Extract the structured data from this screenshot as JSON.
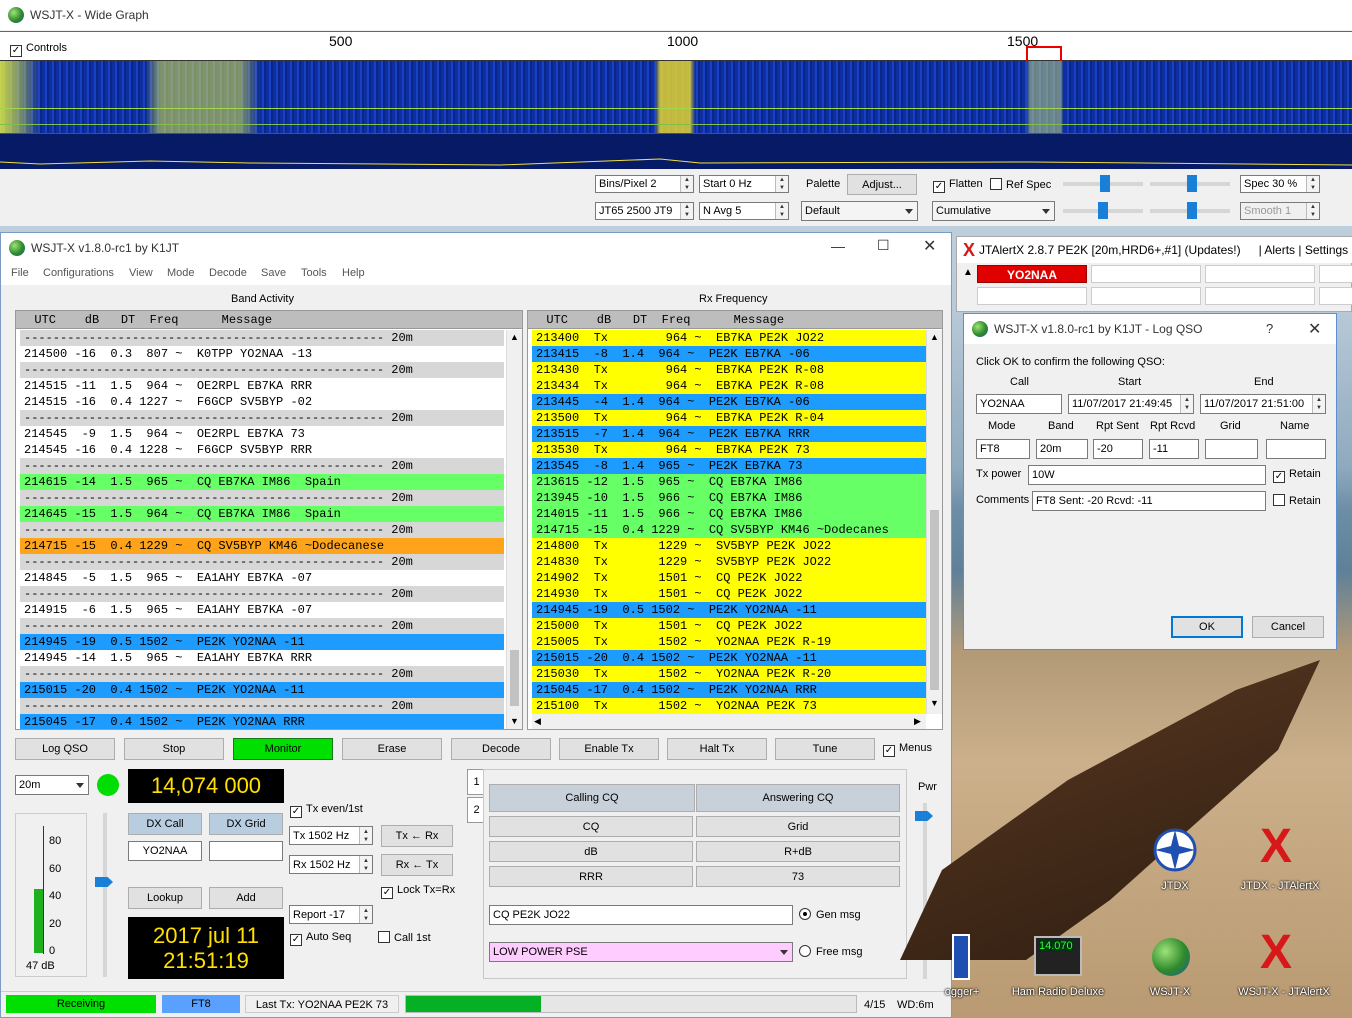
{
  "wide_graph": {
    "title": "WSJT-X - Wide Graph",
    "controls_label": "Controls",
    "scale": [
      "500",
      "1000",
      "1500"
    ],
    "bins_pixel": "Bins/Pixel  2",
    "start": "Start 0 Hz",
    "palette_label": "Palette",
    "adjust_btn": "Adjust...",
    "mode_field": "JT65  2500  JT9",
    "navg": "N Avg 5",
    "palette_value": "Default",
    "flatten": "Flatten",
    "ref_spec": "Ref Spec",
    "spec": "Spec 30 %",
    "cumulative": "Cumulative",
    "smooth": "Smooth  1"
  },
  "main": {
    "title": "WSJT-X   v1.8.0-rc1   by K1JT",
    "menu": [
      "File",
      "Configurations",
      "View",
      "Mode",
      "Decode",
      "Save",
      "Tools",
      "Help"
    ],
    "band_activity_label": "Band Activity",
    "rx_frequency_label": "Rx Frequency",
    "band_header": "  UTC    dB   DT  Freq      Message",
    "rx_header": "  UTC    dB   DT  Freq      Message",
    "band_rows": [
      {
        "t": "-------------------------------------------------- 20m",
        "c": "sep"
      },
      {
        "t": "214500 -16  0.3  807 ~  K0TPP YO2NAA -13",
        "c": "white"
      },
      {
        "t": "-------------------------------------------------- 20m",
        "c": "sep"
      },
      {
        "t": "214515 -11  1.5  964 ~  OE2RPL EB7KA RRR",
        "c": "white"
      },
      {
        "t": "214515 -16  0.4 1227 ~  F6GCP SV5BYP -02",
        "c": "white"
      },
      {
        "t": "-------------------------------------------------- 20m",
        "c": "sep"
      },
      {
        "t": "214545  -9  1.5  964 ~  OE2RPL EB7KA 73",
        "c": "white"
      },
      {
        "t": "214545 -16  0.4 1228 ~  F6GCP SV5BYP RRR",
        "c": "white"
      },
      {
        "t": "-------------------------------------------------- 20m",
        "c": "sep"
      },
      {
        "t": "214615 -14  1.5  965 ~  CQ EB7KA IM86  Spain",
        "c": "green"
      },
      {
        "t": "-------------------------------------------------- 20m",
        "c": "sep"
      },
      {
        "t": "214645 -15  1.5  964 ~  CQ EB7KA IM86  Spain",
        "c": "green"
      },
      {
        "t": "-------------------------------------------------- 20m",
        "c": "sep"
      },
      {
        "t": "214715 -15  0.4 1229 ~  CQ SV5BYP KM46 ~Dodecanese",
        "c": "orange"
      },
      {
        "t": "-------------------------------------------------- 20m",
        "c": "sep"
      },
      {
        "t": "214845  -5  1.5  965 ~  EA1AHY EB7KA -07",
        "c": "white"
      },
      {
        "t": "-------------------------------------------------- 20m",
        "c": "sep"
      },
      {
        "t": "214915  -6  1.5  965 ~  EA1AHY EB7KA -07",
        "c": "white"
      },
      {
        "t": "-------------------------------------------------- 20m",
        "c": "sep"
      },
      {
        "t": "214945 -19  0.5 1502 ~  PE2K YO2NAA -11",
        "c": "blue"
      },
      {
        "t": "214945 -14  1.5  965 ~  EA1AHY EB7KA RRR",
        "c": "white"
      },
      {
        "t": "-------------------------------------------------- 20m",
        "c": "sep"
      },
      {
        "t": "215015 -20  0.4 1502 ~  PE2K YO2NAA -11",
        "c": "blue"
      },
      {
        "t": "-------------------------------------------------- 20m",
        "c": "sep"
      },
      {
        "t": "215045 -17  0.4 1502 ~  PE2K YO2NAA RRR",
        "c": "blue"
      }
    ],
    "rx_rows": [
      {
        "t": "213400  Tx        964 ~  EB7KA PE2K JO22",
        "c": "yellow"
      },
      {
        "t": "213415  -8  1.4  964 ~  PE2K EB7KA -06",
        "c": "blue"
      },
      {
        "t": "213430  Tx        964 ~  EB7KA PE2K R-08",
        "c": "yellow"
      },
      {
        "t": "213434  Tx        964 ~  EB7KA PE2K R-08",
        "c": "yellow"
      },
      {
        "t": "213445  -4  1.4  964 ~  PE2K EB7KA -06",
        "c": "blue"
      },
      {
        "t": "213500  Tx        964 ~  EB7KA PE2K R-04",
        "c": "yellow"
      },
      {
        "t": "213515  -7  1.4  964 ~  PE2K EB7KA RRR",
        "c": "blue"
      },
      {
        "t": "213530  Tx        964 ~  EB7KA PE2K 73",
        "c": "yellow"
      },
      {
        "t": "213545  -8  1.4  965 ~  PE2K EB7KA 73",
        "c": "blue"
      },
      {
        "t": "213615 -12  1.5  965 ~  CQ EB7KA IM86",
        "c": "green"
      },
      {
        "t": "213945 -10  1.5  966 ~  CQ EB7KA IM86",
        "c": "green"
      },
      {
        "t": "214015 -11  1.5  966 ~  CQ EB7KA IM86",
        "c": "green"
      },
      {
        "t": "214715 -15  0.4 1229 ~  CQ SV5BYP KM46 ~Dodecanes",
        "c": "green"
      },
      {
        "t": "214800  Tx       1229 ~  SV5BYP PE2K JO22",
        "c": "yellow"
      },
      {
        "t": "214830  Tx       1229 ~  SV5BYP PE2K JO22",
        "c": "yellow"
      },
      {
        "t": "214902  Tx       1501 ~  CQ PE2K JO22",
        "c": "yellow"
      },
      {
        "t": "214930  Tx       1501 ~  CQ PE2K JO22",
        "c": "yellow"
      },
      {
        "t": "214945 -19  0.5 1502 ~  PE2K YO2NAA -11",
        "c": "blue"
      },
      {
        "t": "215000  Tx       1501 ~  CQ PE2K JO22",
        "c": "yellow"
      },
      {
        "t": "215005  Tx       1502 ~  YO2NAA PE2K R-19",
        "c": "yellow"
      },
      {
        "t": "215015 -20  0.4 1502 ~  PE2K YO2NAA -11",
        "c": "blue"
      },
      {
        "t": "215030  Tx       1502 ~  YO2NAA PE2K R-20",
        "c": "yellow"
      },
      {
        "t": "215045 -17  0.4 1502 ~  PE2K YO2NAA RRR",
        "c": "blue"
      },
      {
        "t": "215100  Tx       1502 ~  YO2NAA PE2K 73",
        "c": "yellow"
      }
    ],
    "buttons": {
      "log_qso": "Log QSO",
      "stop": "Stop",
      "monitor": "Monitor",
      "erase": "Erase",
      "decode": "Decode",
      "enable_tx": "Enable Tx",
      "halt_tx": "Halt Tx",
      "tune": "Tune",
      "menus": "Menus"
    },
    "band": "20m",
    "frequency": "14,074 000",
    "dx_call_btn": "DX Call",
    "dx_grid_btn": "DX Grid",
    "dx_call_value": "YO2NAA",
    "dx_grid_value": "",
    "lookup_btn": "Lookup",
    "add_btn": "Add",
    "meter_ticks": [
      "80",
      "60",
      "40",
      "20",
      "0"
    ],
    "meter_db": "47 dB",
    "date": "2017 jul 11",
    "time": "21:51:19",
    "tx_even": "Tx even/1st",
    "tx_hz": "Tx  1502  Hz",
    "rx_hz": "Rx  1502  Hz",
    "tx_from_rx": "Tx ← Rx",
    "rx_from_tx": "Rx ← Tx",
    "lock_tx_rx": "Lock Tx=Rx",
    "report": "Report -17",
    "auto_seq": "Auto Seq",
    "call_1st": "Call 1st",
    "tab1": "1",
    "tab2": "2",
    "calling_cq": "Calling CQ",
    "answering_cq": "Answering CQ",
    "cq": "CQ",
    "grid": "Grid",
    "db": "dB",
    "r_db": "R+dB",
    "rrr": "RRR",
    "seventy_three": "73",
    "gen_msg_text": "CQ PE2K JO22",
    "gen_msg": "Gen msg",
    "free_msg_text": "LOW POWER PSE",
    "free_msg": "Free msg",
    "pwr": "Pwr",
    "status": {
      "receiving": "Receiving",
      "mode": "FT8",
      "last_tx": "Last Tx: YO2NAA PE2K 73",
      "progress": 0.3,
      "count": "4/15",
      "wd": "WD:6m"
    }
  },
  "jtalert": {
    "title": "JTAlertX 2.8.7 PE2K [20m,HRD6+,#1] (Updates!)",
    "links": "| Alerts | Settings | V",
    "callsign": "YO2NAA"
  },
  "logqso": {
    "title": "WSJT-X   v1.8.0-rc1   by K1JT - Log QSO",
    "help": "?",
    "prompt": "Click OK to confirm the following QSO:",
    "call_label": "Call",
    "start_label": "Start",
    "end_label": "End",
    "call": "YO2NAA",
    "start": "11/07/2017 21:49:45",
    "end": "11/07/2017 21:51:00",
    "mode_label": "Mode",
    "band_label": "Band",
    "sent_label": "Rpt Sent",
    "rcvd_label": "Rpt Rcvd",
    "grid_label": "Grid",
    "name_label": "Name",
    "mode": "FT8",
    "band": "20m",
    "sent": "-20",
    "rcvd": "-11",
    "grid": "",
    "name": "",
    "txpower_label": "Tx power",
    "txpower": "10W",
    "retain": "Retain",
    "comments_label": "Comments",
    "comments": "FT8  Sent: -20  Rcvd: -11",
    "ok": "OK",
    "cancel": "Cancel"
  },
  "desktop": {
    "icons": [
      "JTDX",
      "JTDX - JTAlertX",
      "ogger+",
      "Ham Radio Deluxe",
      "WSJT-X",
      "WSJT-X - JTAlertX"
    ],
    "hrd_display": "14.070"
  },
  "colors": {
    "green": "#66ff66",
    "yellow": "#ffff00",
    "blue": "#1e9bff",
    "orange": "#ffa31a",
    "monitor": "#00e000",
    "receiving": "#00e000",
    "freq_digits": "#ffe000",
    "mode_badge": "#5aa0ff",
    "free_msg_bg": "#ffccff"
  }
}
